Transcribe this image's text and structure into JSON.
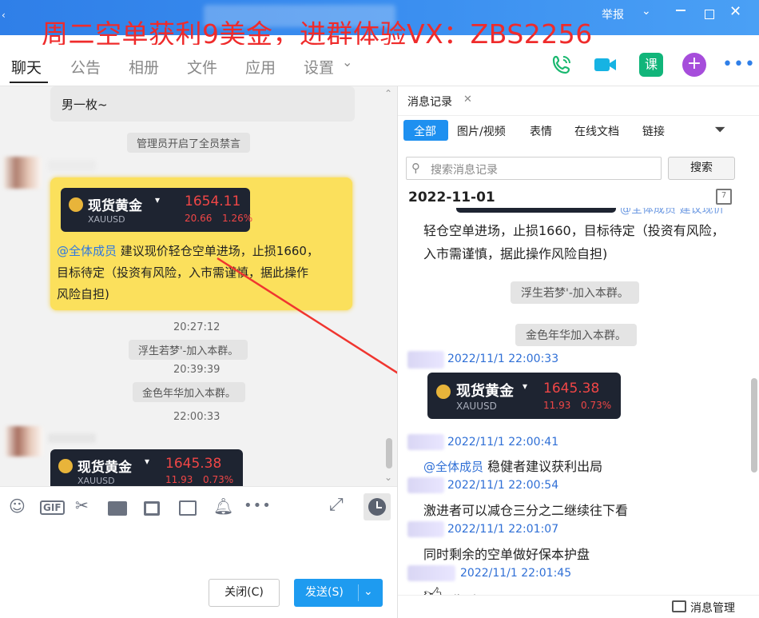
{
  "banner": "周二空单获利9美金，进群体验VX：ZBS2256",
  "window": {
    "report": "举报"
  },
  "tabs": [
    "聊天",
    "公告",
    "相册",
    "文件",
    "应用",
    "设置"
  ],
  "chat": {
    "msg_top": "男一枚~",
    "system_mute": "管理员开启了全员禁言",
    "card1": {
      "name": "现货黄金",
      "code": "XAUUSD",
      "price": "1654.11",
      "change": "20.66",
      "pct": "1.26%"
    },
    "highlight_mention": "@全体成员",
    "highlight_line1": " 建议现价轻仓空单进场，止损1660，",
    "highlight_line2": "目标待定（投资有风险，入市需谨慎，据此操作",
    "highlight_line3": "风险自担)",
    "t1": "20:27:12",
    "join1": "浮生若梦'-加入本群。",
    "t2": "20:39:39",
    "join2": "金色年华加入本群。",
    "t3": "22:00:33",
    "card2": {
      "name": "现货黄金",
      "code": "XAUUSD",
      "price": "1645.38",
      "change": "11.93",
      "pct": "0.73%"
    }
  },
  "input": {
    "close": "关闭(C)",
    "send": "发送(S)"
  },
  "history": {
    "tab_title": "消息记录",
    "filters": [
      "全部",
      "图片/视频",
      "表情",
      "在线文档",
      "链接"
    ],
    "search_placeholder": "搜索消息记录",
    "search_button": "搜索",
    "date": "2022-11-01",
    "cut_line": "@全体成员 建议现价",
    "line1": "轻仓空单进场，止损1660，目标待定（投资有风险，",
    "line2": "入市需谨慎，据此操作风险自担)",
    "join1": "浮生若梦'-加入本群。",
    "join2": "金色年华加入本群。",
    "m1_time": "2022/11/1 22:00:33",
    "card": {
      "name": "现货黄金",
      "code": "XAUUSD",
      "price": "1645.38",
      "change": "11.93",
      "pct": "0.73%"
    },
    "m2_time": "2022/11/1 22:00:41",
    "m2_mention": "@全体成员",
    "m2_text": " 稳健者建议获利出局",
    "m3_time": "2022/11/1 22:00:54",
    "m3_text": "激进者可以减仓三分之二继续往下看",
    "m4_time": "2022/11/1 22:01:07",
    "m4_text": "同时剩余的空单做好保本护盘",
    "m5_time": "2022/11/1 22:01:45",
    "m5_text": "收到",
    "manage": "消息管理"
  }
}
